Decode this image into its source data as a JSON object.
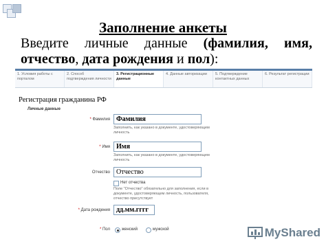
{
  "slide": {
    "title": "Заполнение анкеты",
    "body_line1_parts": [
      "Введите",
      "личные",
      "данные",
      "(фамилия,",
      "имя,"
    ],
    "body_line2_bold1": "отчество",
    "body_line2_sep": ", ",
    "body_line2_bold2": "дата рождения",
    "body_line2_mid": " и ",
    "body_line2_bold3": "пол",
    "body_line2_end": "):"
  },
  "steps": [
    {
      "label": "1. Условия работы с порталом",
      "active": false
    },
    {
      "label": "2. Способ подтверждения личности",
      "active": false
    },
    {
      "label": "3. Регистрационные данные",
      "active": true
    },
    {
      "label": "4. Данные авторизации",
      "active": false
    },
    {
      "label": "5. Подтверждение контактных данных",
      "active": false
    },
    {
      "label": "6. Результат регистрации",
      "active": false
    }
  ],
  "form": {
    "title": "Регистрация гражданина РФ",
    "section": "Личные данные",
    "lastname": {
      "label": "Фамилия",
      "value": "Фамилия",
      "hint": "Заполнить, как указано в документе, удостоверяющем личность"
    },
    "firstname": {
      "label": "Имя",
      "value": "Имя",
      "hint": "Заполнить, как указано в документе, удостоверяющем личность"
    },
    "patronymic": {
      "label": "Отчество",
      "value": "Отчество",
      "no_patronymic": "Нет отчества",
      "hint": "Поле \"Отчество\" обязательно для заполнения, если в документе, удостоверяющем личность, пользователя, отчество присутствует"
    },
    "birthdate": {
      "label": "Дата рождения",
      "value": "дд.мм.гггг"
    },
    "gender": {
      "label": "Пол",
      "male": "женский",
      "female": "мужской",
      "selected": "женский"
    },
    "required_mark": "*"
  },
  "logo": {
    "text": "MyShared"
  }
}
